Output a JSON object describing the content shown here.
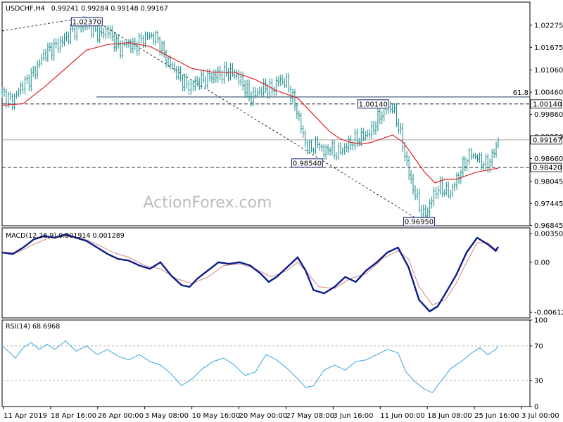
{
  "chart_data": [
    {
      "type": "candlestick",
      "symbol_header": "USDCHF,H4",
      "ohlc_header": "0.99241 0.99284 0.99148 0.99167",
      "ylim": [
        0.9684,
        1.029
      ],
      "right_ticks": [
        "1.02275",
        "1.01675",
        "1.01060",
        "1.00460",
        "0.99860",
        "0.99250",
        "0.98660",
        "0.98045",
        "0.97445",
        "0.96845"
      ],
      "price_tags": [
        {
          "text": "1.00140",
          "value": 1.0014
        },
        {
          "text": "0.99167",
          "value": 0.99167
        },
        {
          "text": "0.98420",
          "value": 0.9842
        }
      ],
      "annotations": [
        {
          "text": "1.02370",
          "x": 0.1605,
          "y": 1.0237
        },
        {
          "text": "1.00140",
          "x": 0.703,
          "y": 1.0014
        },
        {
          "text": "0.98540",
          "x": 0.578,
          "y": 0.9854
        },
        {
          "text": "0.96950",
          "x": 0.79,
          "y": 0.9695
        }
      ],
      "fib_label": "61.8",
      "fib_level": 1.0033,
      "hlines": [
        1.0014,
        0.99167,
        0.9842
      ],
      "trendlines": [
        {
          "x1": 0.0,
          "y1": 1.0212,
          "x2": 0.165,
          "y2": 1.025
        },
        {
          "x1": 0.165,
          "y1": 1.025,
          "x2": 0.795,
          "y2": 0.9695
        }
      ],
      "close_path": [
        [
          0.0,
          1.0045
        ],
        [
          0.02,
          1.002
        ],
        [
          0.035,
          1.006
        ],
        [
          0.05,
          1.008
        ],
        [
          0.065,
          1.011
        ],
        [
          0.08,
          1.015
        ],
        [
          0.1,
          1.017
        ],
        [
          0.12,
          1.019
        ],
        [
          0.14,
          1.022
        ],
        [
          0.155,
          1.0235
        ],
        [
          0.165,
          1.0225
        ],
        [
          0.185,
          1.02
        ],
        [
          0.2,
          1.0215
        ],
        [
          0.215,
          1.018
        ],
        [
          0.225,
          1.016
        ],
        [
          0.235,
          1.018
        ],
        [
          0.25,
          1.017
        ],
        [
          0.265,
          1.019
        ],
        [
          0.28,
          1.02
        ],
        [
          0.295,
          1.019
        ],
        [
          0.31,
          1.014
        ],
        [
          0.325,
          1.011
        ],
        [
          0.34,
          1.008
        ],
        [
          0.355,
          1.006
        ],
        [
          0.37,
          1.0075
        ],
        [
          0.385,
          1.008
        ],
        [
          0.4,
          1.009
        ],
        [
          0.415,
          1.0095
        ],
        [
          0.43,
          1.01
        ],
        [
          0.445,
          1.009
        ],
        [
          0.46,
          1.006
        ],
        [
          0.47,
          1.003
        ],
        [
          0.48,
          1.004
        ],
        [
          0.49,
          1.005
        ],
        [
          0.5,
          1.006
        ],
        [
          0.51,
          1.005
        ],
        [
          0.525,
          1.008
        ],
        [
          0.54,
          1.007
        ],
        [
          0.55,
          1.003
        ],
        [
          0.56,
          0.999
        ],
        [
          0.57,
          0.993
        ],
        [
          0.58,
          0.989
        ],
        [
          0.59,
          0.99
        ],
        [
          0.6,
          0.991
        ],
        [
          0.61,
          0.988
        ],
        [
          0.62,
          0.99
        ],
        [
          0.63,
          0.988
        ],
        [
          0.645,
          0.989
        ],
        [
          0.66,
          0.991
        ],
        [
          0.675,
          0.992
        ],
        [
          0.69,
          0.993
        ],
        [
          0.7,
          0.994
        ],
        [
          0.71,
          0.997
        ],
        [
          0.72,
          0.999
        ],
        [
          0.73,
          1.0005
        ],
        [
          0.74,
          1.0
        ],
        [
          0.75,
          0.996
        ],
        [
          0.76,
          0.99
        ],
        [
          0.77,
          0.983
        ],
        [
          0.78,
          0.978
        ],
        [
          0.79,
          0.974
        ],
        [
          0.798,
          0.971
        ],
        [
          0.808,
          0.973
        ],
        [
          0.818,
          0.977
        ],
        [
          0.828,
          0.979
        ],
        [
          0.838,
          0.978
        ],
        [
          0.848,
          0.977
        ],
        [
          0.858,
          0.98
        ],
        [
          0.868,
          0.983
        ],
        [
          0.878,
          0.986
        ],
        [
          0.888,
          0.988
        ],
        [
          0.898,
          0.987
        ],
        [
          0.908,
          0.986
        ],
        [
          0.918,
          0.985
        ],
        [
          0.928,
          0.987
        ],
        [
          0.936,
          0.99
        ],
        [
          0.94,
          0.9917
        ]
      ],
      "ma_path": [
        [
          0.0,
          1.001
        ],
        [
          0.04,
          1.0015
        ],
        [
          0.08,
          1.006
        ],
        [
          0.12,
          1.011
        ],
        [
          0.16,
          1.016
        ],
        [
          0.2,
          1.0175
        ],
        [
          0.24,
          1.018
        ],
        [
          0.28,
          1.017
        ],
        [
          0.32,
          1.014
        ],
        [
          0.36,
          1.011
        ],
        [
          0.4,
          1.01
        ],
        [
          0.44,
          1.01
        ],
        [
          0.48,
          1.008
        ],
        [
          0.52,
          1.005
        ],
        [
          0.56,
          1.003
        ],
        [
          0.58,
          1.0
        ],
        [
          0.6,
          0.997
        ],
        [
          0.62,
          0.994
        ],
        [
          0.64,
          0.992
        ],
        [
          0.66,
          0.991
        ],
        [
          0.68,
          0.9905
        ],
        [
          0.7,
          0.991
        ],
        [
          0.72,
          0.992
        ],
        [
          0.74,
          0.993
        ],
        [
          0.76,
          0.991
        ],
        [
          0.78,
          0.987
        ],
        [
          0.8,
          0.983
        ],
        [
          0.82,
          0.98
        ],
        [
          0.84,
          0.981
        ],
        [
          0.86,
          0.981
        ],
        [
          0.88,
          0.982
        ],
        [
          0.9,
          0.983
        ],
        [
          0.92,
          0.9835
        ],
        [
          0.94,
          0.984
        ]
      ]
    },
    {
      "type": "line",
      "header": "MACD(12,26,9) 0.001914 0.001289",
      "ylim": [
        -0.0068,
        0.0042
      ],
      "right_ticks": [
        {
          "text": "0.003508",
          "value": 0.003508
        },
        {
          "text": "0.00",
          "value": 0.0
        },
        {
          "text": "-0.006121",
          "value": -0.006121
        }
      ],
      "series": [
        {
          "values_path": [
            [
              0.0,
              0.0012
            ],
            [
              0.02,
              0.001
            ],
            [
              0.04,
              0.0018
            ],
            [
              0.06,
              0.0028
            ],
            [
              0.08,
              0.0032
            ],
            [
              0.1,
              0.003
            ],
            [
              0.12,
              0.0034
            ],
            [
              0.14,
              0.003
            ],
            [
              0.16,
              0.0026
            ],
            [
              0.18,
              0.0018
            ],
            [
              0.2,
              0.001
            ],
            [
              0.22,
              0.0004
            ],
            [
              0.24,
              0.0002
            ],
            [
              0.26,
              -0.0004
            ],
            [
              0.28,
              -0.0008
            ],
            [
              0.3,
              0.0
            ],
            [
              0.32,
              -0.0016
            ],
            [
              0.34,
              -0.0028
            ],
            [
              0.355,
              -0.003
            ],
            [
              0.37,
              -0.002
            ],
            [
              0.39,
              -0.001
            ],
            [
              0.41,
              0.0
            ],
            [
              0.43,
              -0.0002
            ],
            [
              0.45,
              0.0
            ],
            [
              0.47,
              -0.0004
            ],
            [
              0.49,
              -0.0014
            ],
            [
              0.505,
              -0.0024
            ],
            [
              0.52,
              -0.0018
            ],
            [
              0.54,
              -0.0006
            ],
            [
              0.56,
              0.0006
            ],
            [
              0.575,
              -0.001
            ],
            [
              0.59,
              -0.0034
            ],
            [
              0.61,
              -0.0038
            ],
            [
              0.63,
              -0.003
            ],
            [
              0.65,
              -0.0018
            ],
            [
              0.67,
              -0.0024
            ],
            [
              0.69,
              -0.001
            ],
            [
              0.71,
              0.0
            ],
            [
              0.73,
              0.0012
            ],
            [
              0.75,
              0.0018
            ],
            [
              0.77,
              -0.0006
            ],
            [
              0.79,
              -0.0046
            ],
            [
              0.81,
              -0.006
            ],
            [
              0.825,
              -0.0054
            ],
            [
              0.84,
              -0.0038
            ],
            [
              0.86,
              -0.0016
            ],
            [
              0.88,
              0.0012
            ],
            [
              0.9,
              0.003
            ],
            [
              0.92,
              0.0022
            ],
            [
              0.935,
              0.0014
            ],
            [
              0.94,
              0.0019
            ]
          ]
        },
        {
          "values_path": [
            [
              0.0,
              0.0012
            ],
            [
              0.03,
              0.0012
            ],
            [
              0.06,
              0.0022
            ],
            [
              0.09,
              0.003
            ],
            [
              0.12,
              0.0032
            ],
            [
              0.15,
              0.003
            ],
            [
              0.18,
              0.0022
            ],
            [
              0.21,
              0.0012
            ],
            [
              0.24,
              0.0006
            ],
            [
              0.27,
              -0.0004
            ],
            [
              0.3,
              -0.0008
            ],
            [
              0.33,
              -0.002
            ],
            [
              0.36,
              -0.0026
            ],
            [
              0.39,
              -0.0018
            ],
            [
              0.42,
              -0.0004
            ],
            [
              0.45,
              -0.0002
            ],
            [
              0.48,
              -0.0008
            ],
            [
              0.51,
              -0.0018
            ],
            [
              0.54,
              -0.001
            ],
            [
              0.56,
              0.0
            ],
            [
              0.58,
              -0.0014
            ],
            [
              0.6,
              -0.003
            ],
            [
              0.63,
              -0.0032
            ],
            [
              0.66,
              -0.002
            ],
            [
              0.69,
              -0.0014
            ],
            [
              0.72,
              0.0004
            ],
            [
              0.75,
              0.0014
            ],
            [
              0.77,
              0.0004
            ],
            [
              0.79,
              -0.003
            ],
            [
              0.815,
              -0.0052
            ],
            [
              0.84,
              -0.0046
            ],
            [
              0.86,
              -0.0026
            ],
            [
              0.88,
              0.0
            ],
            [
              0.9,
              0.0024
            ],
            [
              0.92,
              0.0024
            ],
            [
              0.94,
              0.0013
            ]
          ]
        }
      ]
    },
    {
      "type": "line",
      "header": "RSI(14) 68.6968",
      "ylim": [
        0,
        100
      ],
      "right_ticks": [
        {
          "text": "100",
          "value": 100
        },
        {
          "text": "70",
          "value": 70
        },
        {
          "text": "30",
          "value": 30
        },
        {
          "text": "0",
          "value": 0
        }
      ],
      "hlines": [
        70,
        30
      ],
      "values_path": [
        [
          0.0,
          70
        ],
        [
          0.015,
          62
        ],
        [
          0.025,
          56
        ],
        [
          0.04,
          68
        ],
        [
          0.055,
          74
        ],
        [
          0.07,
          66
        ],
        [
          0.085,
          72
        ],
        [
          0.1,
          66
        ],
        [
          0.12,
          76
        ],
        [
          0.14,
          64
        ],
        [
          0.16,
          70
        ],
        [
          0.18,
          60
        ],
        [
          0.2,
          66
        ],
        [
          0.22,
          58
        ],
        [
          0.24,
          54
        ],
        [
          0.26,
          60
        ],
        [
          0.28,
          52
        ],
        [
          0.3,
          48
        ],
        [
          0.32,
          38
        ],
        [
          0.34,
          24
        ],
        [
          0.36,
          32
        ],
        [
          0.38,
          44
        ],
        [
          0.4,
          52
        ],
        [
          0.42,
          56
        ],
        [
          0.44,
          48
        ],
        [
          0.46,
          36
        ],
        [
          0.48,
          40
        ],
        [
          0.5,
          60
        ],
        [
          0.52,
          54
        ],
        [
          0.54,
          44
        ],
        [
          0.56,
          32
        ],
        [
          0.575,
          22
        ],
        [
          0.59,
          24
        ],
        [
          0.61,
          42
        ],
        [
          0.63,
          48
        ],
        [
          0.65,
          42
        ],
        [
          0.67,
          52
        ],
        [
          0.69,
          54
        ],
        [
          0.71,
          60
        ],
        [
          0.73,
          66
        ],
        [
          0.75,
          62
        ],
        [
          0.765,
          40
        ],
        [
          0.78,
          30
        ],
        [
          0.8,
          20
        ],
        [
          0.815,
          16
        ],
        [
          0.83,
          28
        ],
        [
          0.85,
          44
        ],
        [
          0.87,
          52
        ],
        [
          0.89,
          62
        ],
        [
          0.905,
          68
        ],
        [
          0.92,
          60
        ],
        [
          0.935,
          66
        ],
        [
          0.94,
          70
        ]
      ]
    }
  ],
  "x_tick_labels": [
    "11 Apr 2019",
    "18 Apr 16:00",
    "26 Apr 00:00",
    "3 May 08:00",
    "10 May 16:00",
    "20 May 00:00",
    "27 May 08:00",
    "3 Jun 16:00",
    "11 Jun 00:00",
    "18 Jun 08:00",
    "25 Jun 16:00",
    "3 Jul 00:00"
  ],
  "watermark": "ActionForex.com",
  "colors": {
    "candle": "#1a8a8a",
    "ma": "#e0262b",
    "macd": "#0d1b8a",
    "macd_signal": "#d08a8a",
    "rsi": "#3da5e0",
    "dashed": "#000000",
    "fib_line": "#1e3a5f",
    "grid_dash": "#9a9a9a"
  }
}
